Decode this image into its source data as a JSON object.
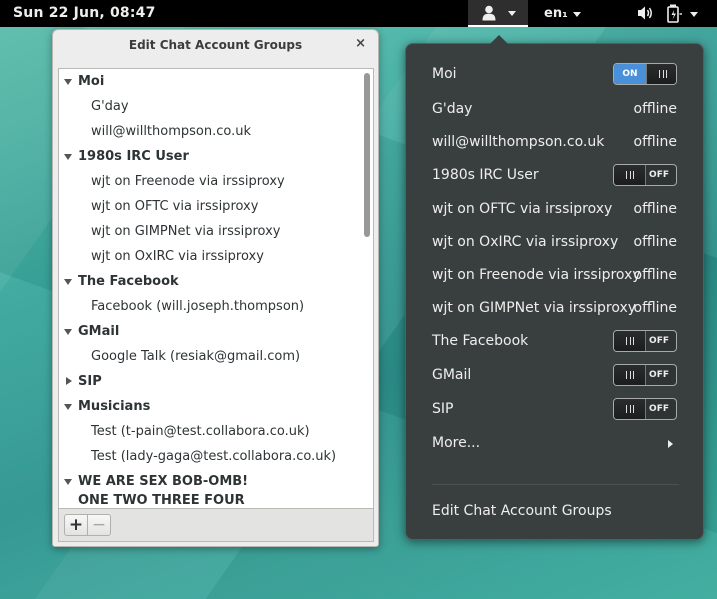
{
  "topbar": {
    "clock": "Sun 22 Jun, 08:47",
    "keyboard_layout": "en₁",
    "icons": [
      "user-icon",
      "volume-icon",
      "battery-icon"
    ]
  },
  "dialog": {
    "title": "Edit Chat Account Groups",
    "close_glyph": "×",
    "tree": [
      {
        "kind": "group",
        "label": "Moi",
        "expanded": true
      },
      {
        "kind": "child",
        "label": "G'day"
      },
      {
        "kind": "child",
        "label": "will@willthompson.co.uk"
      },
      {
        "kind": "group",
        "label": "1980s IRC User",
        "expanded": true
      },
      {
        "kind": "child",
        "label": "wjt on Freenode via irssiproxy"
      },
      {
        "kind": "child",
        "label": "wjt on OFTC via irssiproxy"
      },
      {
        "kind": "child",
        "label": "wjt on GIMPNet via irssiproxy"
      },
      {
        "kind": "child",
        "label": "wjt on OxIRC via irssiproxy"
      },
      {
        "kind": "group",
        "label": "The Facebook",
        "expanded": true
      },
      {
        "kind": "child",
        "label": "Facebook (will.joseph.thompson)"
      },
      {
        "kind": "group",
        "label": "GMail",
        "expanded": true
      },
      {
        "kind": "child",
        "label": "Google Talk (resiak@gmail.com)"
      },
      {
        "kind": "group",
        "label": "SIP",
        "expanded": false
      },
      {
        "kind": "group",
        "label": "Musicians",
        "expanded": true
      },
      {
        "kind": "child",
        "label": "Test (t-pain@test.collabora.co.uk)"
      },
      {
        "kind": "child",
        "label": "Test (lady-gaga@test.collabora.co.uk)"
      },
      {
        "kind": "group",
        "label": "WE ARE SEX BOB-OMB!",
        "expanded": true
      },
      {
        "kind": "group-cont",
        "label": "ONE TWO THREE FOUR"
      }
    ],
    "toolbar": {
      "add_label": "+",
      "remove_label": "−"
    }
  },
  "menu": {
    "items": [
      {
        "label": "Moi",
        "control": "switch",
        "state": "on",
        "on_text": "ON",
        "off_text": "OFF"
      },
      {
        "label": "G'day",
        "control": "status",
        "status": "offline"
      },
      {
        "label": "will@willthompson.co.uk",
        "control": "status",
        "status": "offline"
      },
      {
        "label": "1980s IRC User",
        "control": "switch",
        "state": "off",
        "on_text": "ON",
        "off_text": "OFF"
      },
      {
        "label": "wjt on OFTC via irssiproxy",
        "control": "status",
        "status": "offline"
      },
      {
        "label": "wjt on OxIRC via irssiproxy",
        "control": "status",
        "status": "offline"
      },
      {
        "label": "wjt on Freenode via irssiproxy",
        "control": "status",
        "status": "offline"
      },
      {
        "label": "wjt on GIMPNet via irssiproxy",
        "control": "status",
        "status": "offline"
      },
      {
        "label": "The Facebook",
        "control": "switch",
        "state": "off",
        "on_text": "ON",
        "off_text": "OFF"
      },
      {
        "label": "GMail",
        "control": "switch",
        "state": "off",
        "on_text": "ON",
        "off_text": "OFF"
      },
      {
        "label": "SIP",
        "control": "switch",
        "state": "off",
        "on_text": "ON",
        "off_text": "OFF"
      },
      {
        "label": "More...",
        "control": "submenu"
      }
    ],
    "footer_item": "Edit Chat Account Groups"
  },
  "colors": {
    "switch_on": "#4a90d9",
    "popover_bg": "#393f3f",
    "topbar_bg": "#000000"
  }
}
